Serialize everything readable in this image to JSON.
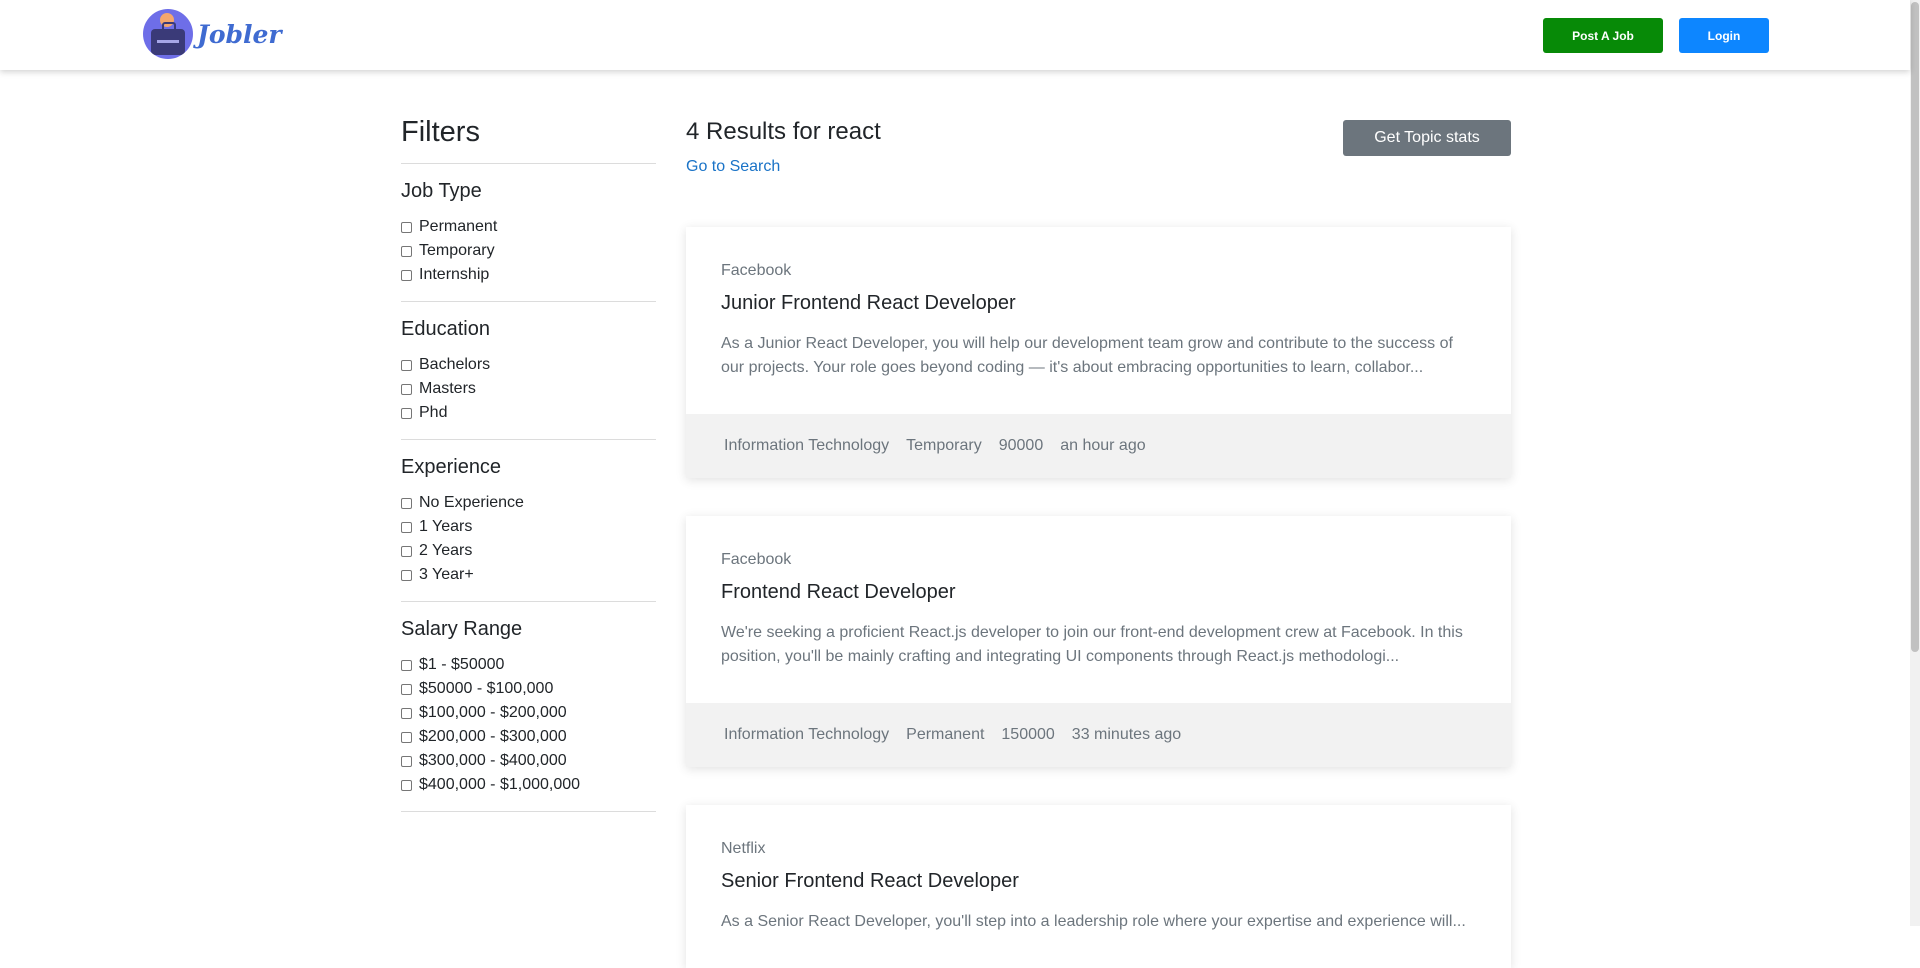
{
  "brand": {
    "name": "Jobler"
  },
  "navbar": {
    "post_job": "Post A Job",
    "login": "Login"
  },
  "sidebar": {
    "title": "Filters",
    "groups": [
      {
        "title": "Job Type",
        "options": [
          "Permanent",
          "Temporary",
          "Internship"
        ]
      },
      {
        "title": "Education",
        "options": [
          "Bachelors",
          "Masters",
          "Phd"
        ]
      },
      {
        "title": "Experience",
        "options": [
          "No Experience",
          "1 Years",
          "2 Years",
          "3 Year+"
        ]
      },
      {
        "title": "Salary Range",
        "options": [
          "$1 - $50000",
          "$50000 - $100,000",
          "$100,000 - $200,000",
          "$200,000 - $300,000",
          "$300,000 - $400,000",
          "$400,000 - $1,000,000"
        ]
      }
    ]
  },
  "results": {
    "title": "4 Results for react",
    "go_search": "Go to Search",
    "stats_button": "Get Topic stats"
  },
  "jobs": [
    {
      "company": "Facebook",
      "title": "Junior Frontend React Developer",
      "description": "As a Junior React Developer, you will help our development team grow and contribute to the success of our projects. Your role goes beyond coding — it's about embracing opportunities to learn, collabor...",
      "industry": "Information Technology",
      "type": "Temporary",
      "salary": "90000",
      "posted": "an hour ago"
    },
    {
      "company": "Facebook",
      "title": "Frontend React Developer",
      "description": "We're seeking a proficient React.js developer to join our front-end development crew at Facebook. In this position, you'll be mainly crafting and integrating UI components through React.js methodologi...",
      "industry": "Information Technology",
      "type": "Permanent",
      "salary": "150000",
      "posted": "33 minutes ago"
    },
    {
      "company": "Netflix",
      "title": "Senior Frontend React Developer",
      "description": "As a Senior React Developer, you'll step into a leadership role where your expertise and experience will..."
    }
  ]
}
